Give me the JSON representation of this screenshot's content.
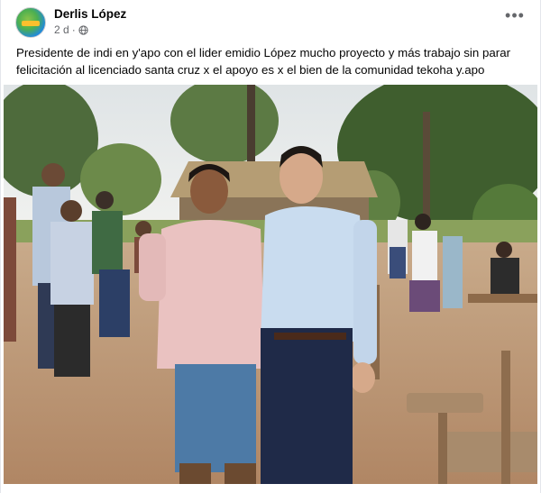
{
  "post": {
    "author": "Derlis López",
    "time": "2 d",
    "separator": "·",
    "privacy_icon": "globe-icon",
    "more_icon": "more-options-icon",
    "more_symbol": "•••",
    "caption_line1": "Presidente de  indi en y'apo con el lider emidio López mucho proyecto y más trabajo sin parar",
    "caption_line2": "felicitación al licenciado santa cruz x el apoyo es x el bien de la comunidad tekoha y.apo"
  },
  "colors": {
    "text_primary": "#050505",
    "text_secondary": "#65676b",
    "divider": "#e4e6eb"
  }
}
